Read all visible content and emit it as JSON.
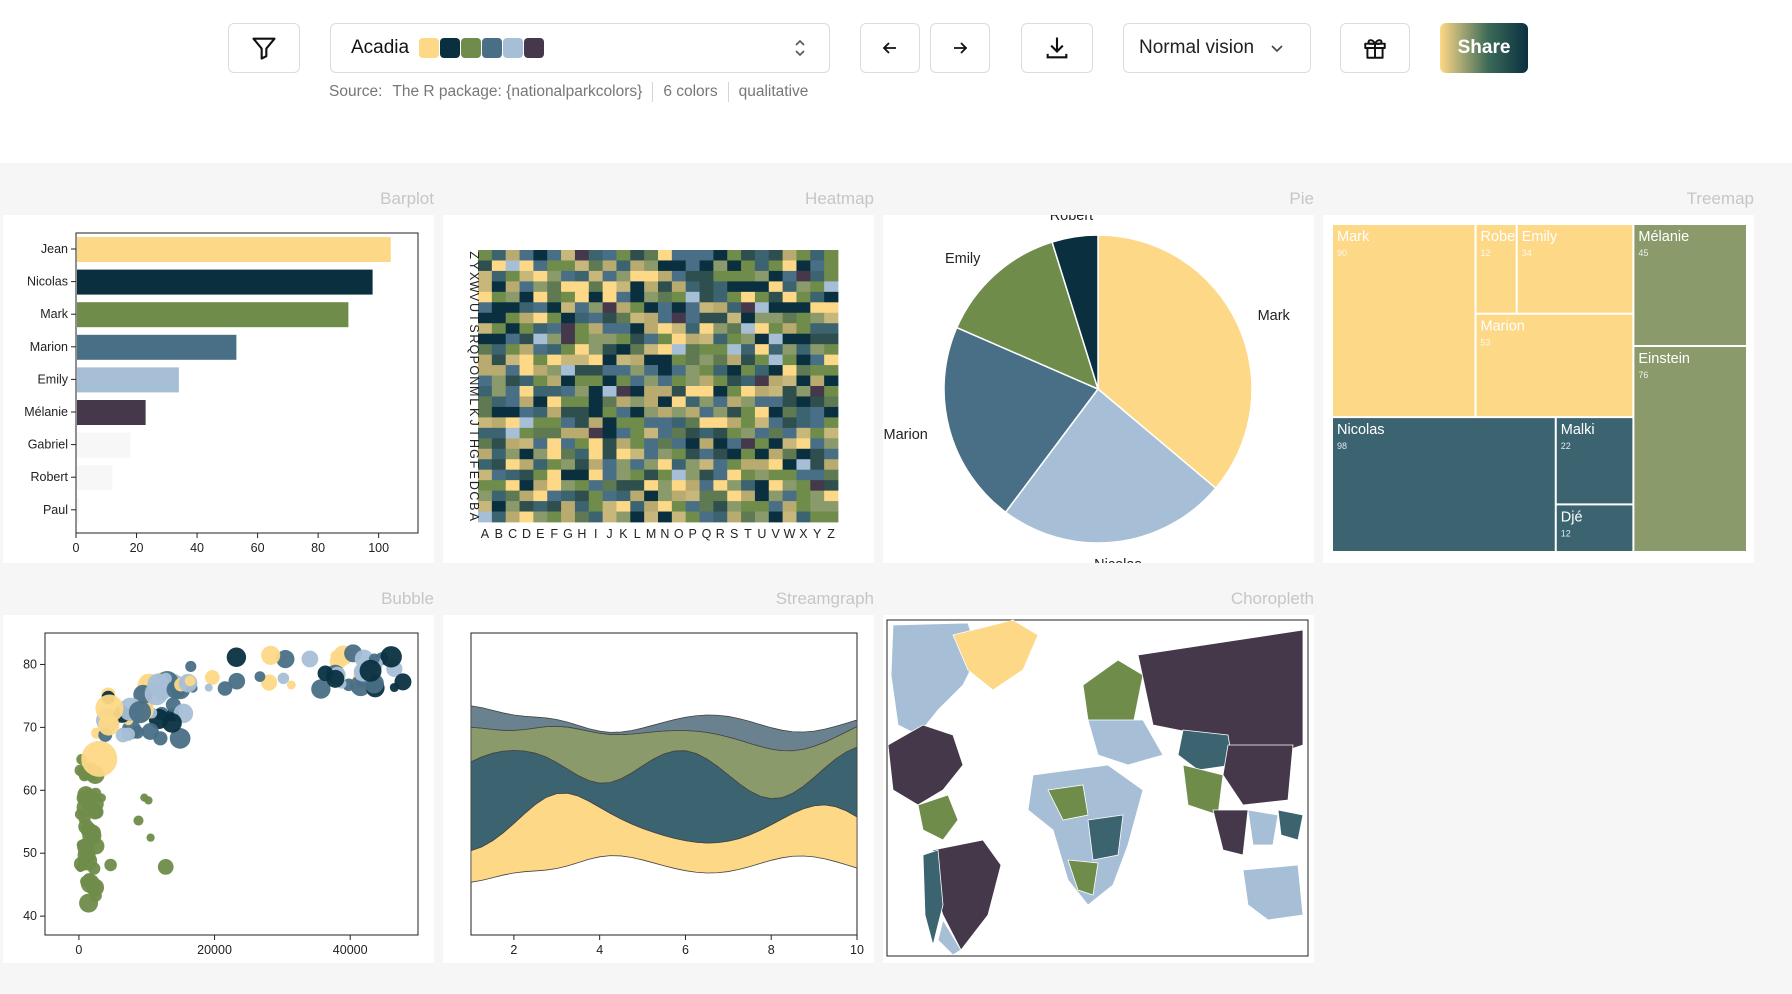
{
  "toolbar": {
    "palette_name": "Acadia",
    "palette_colors": [
      "#fdd886",
      "#0a3040",
      "#6f8c4a",
      "#496f86",
      "#a7bfd6",
      "#44384a"
    ],
    "vision_label": "Normal vision",
    "share_label": "Share",
    "icons": [
      "filter-icon",
      "chevron-up-down-icon",
      "arrow-left-icon",
      "arrow-right-icon",
      "download-icon",
      "chevron-down-icon",
      "gift-icon"
    ]
  },
  "meta": {
    "source_label": "Source:",
    "source_value": "The R package: {nationalparkcolors}",
    "count": "6 colors",
    "kind": "qualitative"
  },
  "titles": {
    "barplot": "Barplot",
    "heatmap": "Heatmap",
    "pie": "Pie",
    "treemap": "Treemap",
    "bubble": "Bubble",
    "streamgraph": "Streamgraph",
    "choropleth": "Choropleth"
  },
  "chart_data": [
    {
      "type": "bar",
      "name": "Barplot",
      "categories": [
        "Jean",
        "Nicolas",
        "Mark",
        "Marion",
        "Emily",
        "Mélanie",
        "Gabriel",
        "Robert",
        "Paul"
      ],
      "values": [
        104,
        98,
        90,
        53,
        34,
        23,
        18,
        12,
        1
      ],
      "colors": [
        "#fdd886",
        "#0a3040",
        "#6f8c4a",
        "#496f86",
        "#a7bfd6",
        "#44384a",
        "#f7f7f7",
        "#f7f7f7",
        "#f7f7f7"
      ],
      "xticks": [
        0,
        20,
        40,
        60,
        80,
        100
      ],
      "xlim": [
        0,
        113
      ]
    },
    {
      "type": "heatmap",
      "name": "Heatmap",
      "x": [
        "A",
        "B",
        "C",
        "D",
        "E",
        "F",
        "G",
        "H",
        "I",
        "J",
        "K",
        "L",
        "M",
        "N",
        "O",
        "P",
        "Q",
        "R",
        "S",
        "T",
        "U",
        "V",
        "W",
        "X",
        "Y",
        "Z"
      ],
      "y": [
        "A",
        "B",
        "C",
        "D",
        "E",
        "F",
        "G",
        "H",
        "I",
        "J",
        "K",
        "L",
        "M",
        "N",
        "O",
        "P",
        "Q",
        "R",
        "S",
        "T",
        "U",
        "V",
        "W",
        "X",
        "Y",
        "Z"
      ]
    },
    {
      "type": "pie",
      "name": "Pie",
      "labels": [
        "Mark",
        "Nicolas",
        "Marion",
        "Emily",
        "Robert"
      ],
      "values": [
        90,
        60,
        53,
        34,
        12
      ],
      "colors": [
        "#fdd886",
        "#a7bfd6",
        "#496f86",
        "#6f8c4a",
        "#0a3040"
      ]
    },
    {
      "type": "treemap",
      "name": "Treemap",
      "groups": [
        {
          "color": "#fdd886",
          "items": [
            {
              "label": "Mark",
              "value": 90
            },
            {
              "label": "Robert",
              "value": 12
            },
            {
              "label": "Emily",
              "value": 34
            },
            {
              "label": "Marion",
              "value": 53
            }
          ]
        },
        {
          "color": "#3b6470",
          "items": [
            {
              "label": "Nicolas",
              "value": 98
            },
            {
              "label": "Malki",
              "value": 22
            },
            {
              "label": "Djé",
              "value": 12
            }
          ]
        },
        {
          "color": "#8b9a6a",
          "items": [
            {
              "label": "Mélanie",
              "value": 45
            },
            {
              "label": "Einstein",
              "value": 76
            }
          ]
        }
      ]
    },
    {
      "type": "scatter",
      "name": "Bubble",
      "xticks": [
        0,
        20000,
        40000
      ],
      "yticks": [
        40,
        50,
        60,
        70,
        80
      ],
      "xlim": [
        -5000,
        50000
      ],
      "ylim": [
        37,
        85
      ]
    },
    {
      "type": "area",
      "name": "Streamgraph",
      "xticks": [
        2,
        4,
        6,
        8,
        10
      ],
      "xlim": [
        1,
        10
      ],
      "series_colors": [
        "#fdd886",
        "#3b6470",
        "#8b9a6a",
        "#6a8290"
      ]
    },
    {
      "type": "map",
      "name": "Choropleth"
    }
  ]
}
